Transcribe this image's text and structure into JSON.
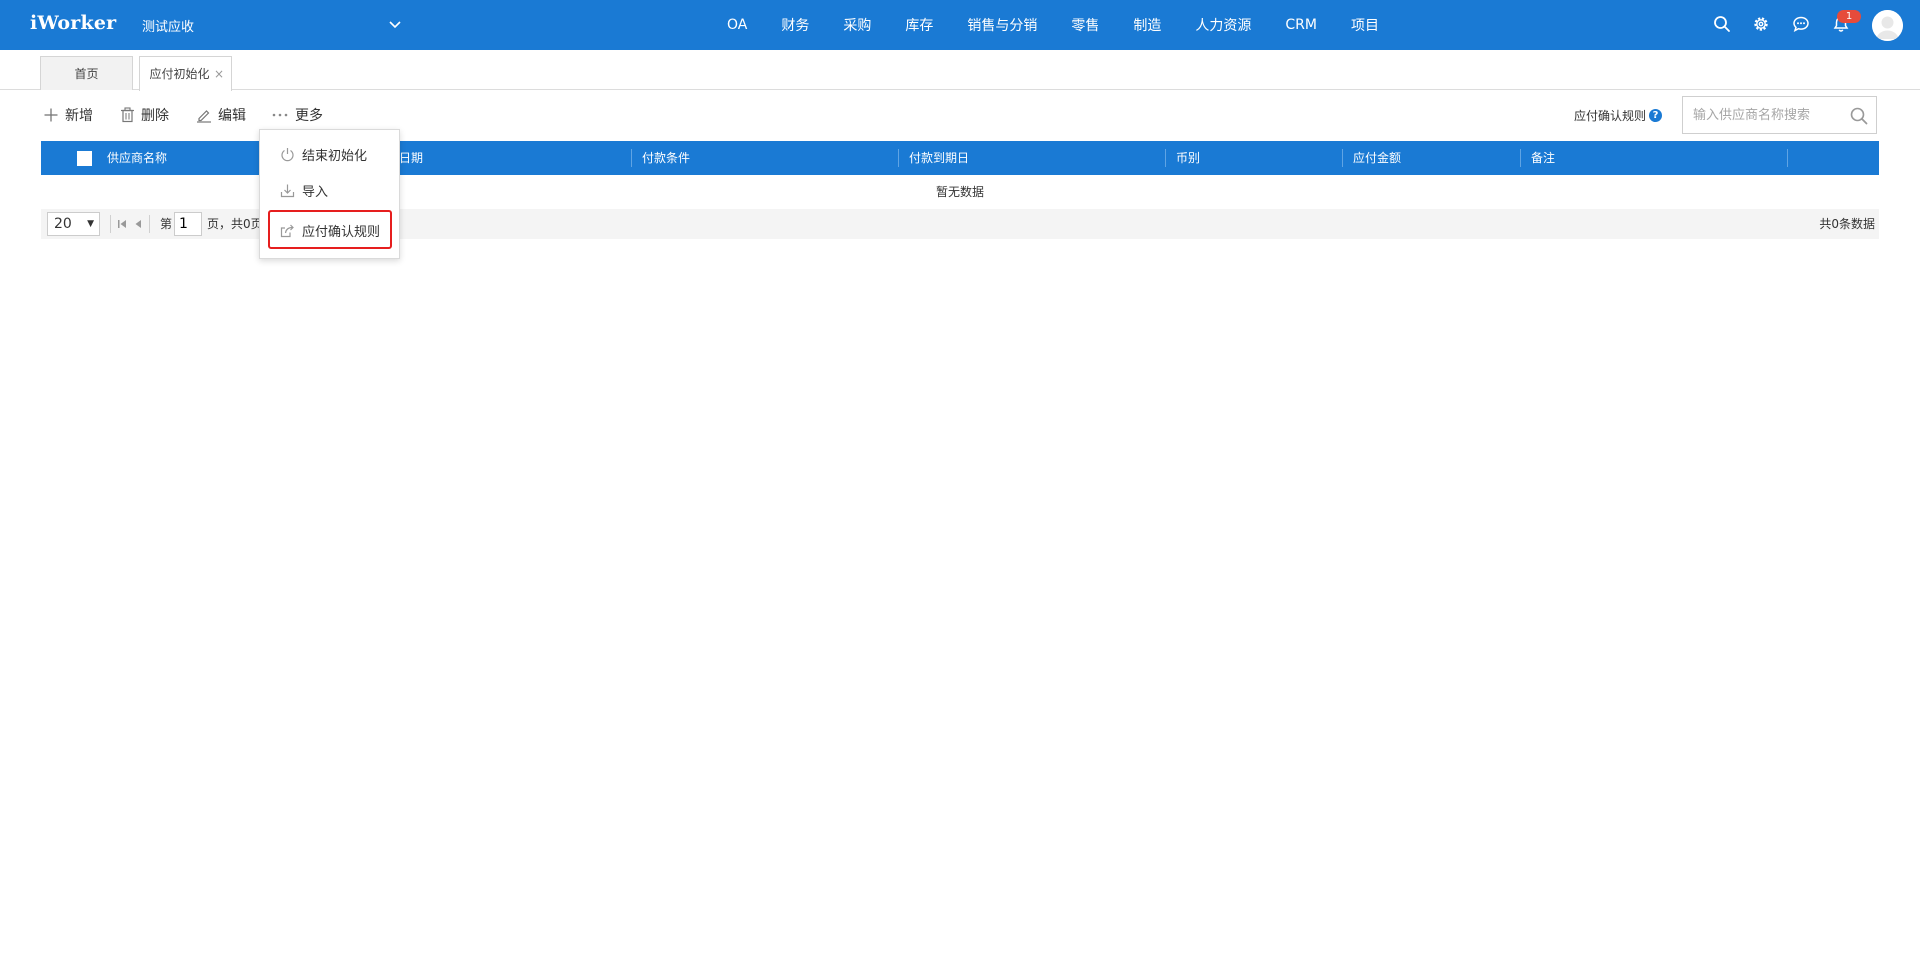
{
  "app": {
    "logo": "iWorker",
    "company": "测试应收"
  },
  "nav": [
    "OA",
    "财务",
    "采购",
    "库存",
    "销售与分销",
    "零售",
    "制造",
    "人力资源",
    "CRM",
    "项目"
  ],
  "notifications": {
    "count": "1"
  },
  "tabs": {
    "home": "首页",
    "active": "应付初始化",
    "close": "×"
  },
  "toolbar": {
    "add": "新增",
    "delete": "删除",
    "edit": "编辑",
    "more": "更多"
  },
  "rule_link": "应付确认规则",
  "help": "?",
  "search": {
    "placeholder": "输入供应商名称搜索",
    "value": ""
  },
  "table": {
    "columns": [
      "供应商名称",
      "日期",
      "付款条件",
      "付款到期日",
      "币别",
      "应付金额",
      "备注"
    ],
    "empty": "暂无数据"
  },
  "pager": {
    "page_size": "20",
    "page_prefix": "第",
    "page": "1",
    "page_suffix": "页，共0页",
    "total": "共0条数据"
  },
  "more_menu": [
    "结束初始化",
    "导入",
    "应付确认规则"
  ],
  "colors": {
    "primary": "#1a7ad4",
    "highlight": "#e61e1e",
    "badge": "#e64b3b"
  }
}
